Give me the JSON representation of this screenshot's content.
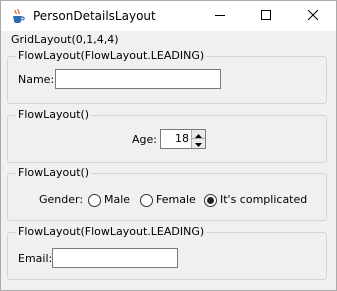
{
  "window": {
    "title": "PersonDetailsLayout",
    "icon": "java-cup-icon",
    "controls": [
      "minimize-icon",
      "maximize-icon",
      "close-icon"
    ]
  },
  "layout_label": "GridLayout(0,1,4,4)",
  "panels": {
    "name": {
      "title": "FlowLayout(FlowLayout.LEADING)",
      "label": "Name:",
      "value": ""
    },
    "age": {
      "title": "FlowLayout()",
      "label": "Age:",
      "value": "18"
    },
    "gender": {
      "title": "FlowLayout()",
      "label": "Gender:",
      "options": [
        {
          "label": "Male",
          "selected": false
        },
        {
          "label": "Female",
          "selected": false
        },
        {
          "label": "It's complicated",
          "selected": true
        }
      ]
    },
    "email": {
      "title": "FlowLayout(FlowLayout.LEADING)",
      "label": "Email:",
      "value": ""
    }
  }
}
